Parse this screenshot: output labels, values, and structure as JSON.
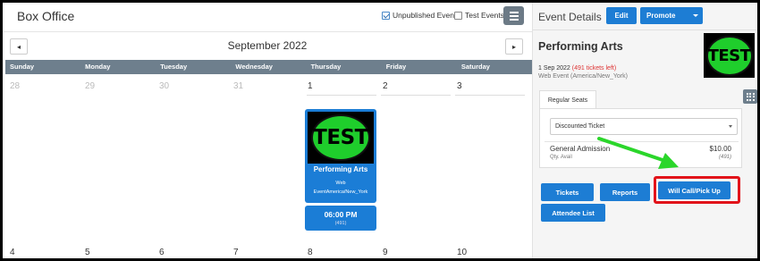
{
  "app": {
    "title": "Box Office",
    "checkbox_unpublished": "Unpublished Events",
    "checkbox_test": "Test Events",
    "unpublished_checked": true,
    "test_checked": false
  },
  "calendar": {
    "month_label": "September 2022",
    "prev_icon": "◂",
    "next_icon": "▸",
    "weekdays": [
      "Sunday",
      "Monday",
      "Tuesday",
      "Wednesday",
      "Thursday",
      "Friday",
      "Saturday"
    ],
    "week1": [
      "28",
      "29",
      "30",
      "31",
      "1",
      "2",
      "3"
    ],
    "week2": [
      "4",
      "5",
      "6",
      "7",
      "8",
      "9",
      "10"
    ]
  },
  "event_card": {
    "logo_text": "TEST",
    "name": "Performing Arts",
    "type": "Web",
    "timezone": "EventAmerica/New_York",
    "time": "06:00 PM",
    "count": "(491)"
  },
  "details": {
    "heading": "Event Details",
    "edit_label": "Edit",
    "promote_label": "Promote",
    "event_title": "Performing Arts",
    "date": "1 Sep 2022",
    "tickets_left": "(491 tickets left)",
    "location": "Web Event (America/New_York)",
    "logo_text": "TEST",
    "tab_label": "Regular Seats",
    "select_value": "Discounted Ticket",
    "ticket_name": "General Admission",
    "ticket_price": "$10.00",
    "qty_label": "Qty. Avail",
    "qty_value": "(491)",
    "buttons": {
      "tickets": "Tickets",
      "reports": "Reports",
      "will_call": "Will Call/Pick Up",
      "attendee_list": "Attendee List"
    }
  },
  "colors": {
    "primary": "#1d7dd4",
    "weekbar": "#6e7f8d",
    "highlight": "#e2131a",
    "arrow": "#2bd62b",
    "logo_green": "#1fce2c"
  }
}
